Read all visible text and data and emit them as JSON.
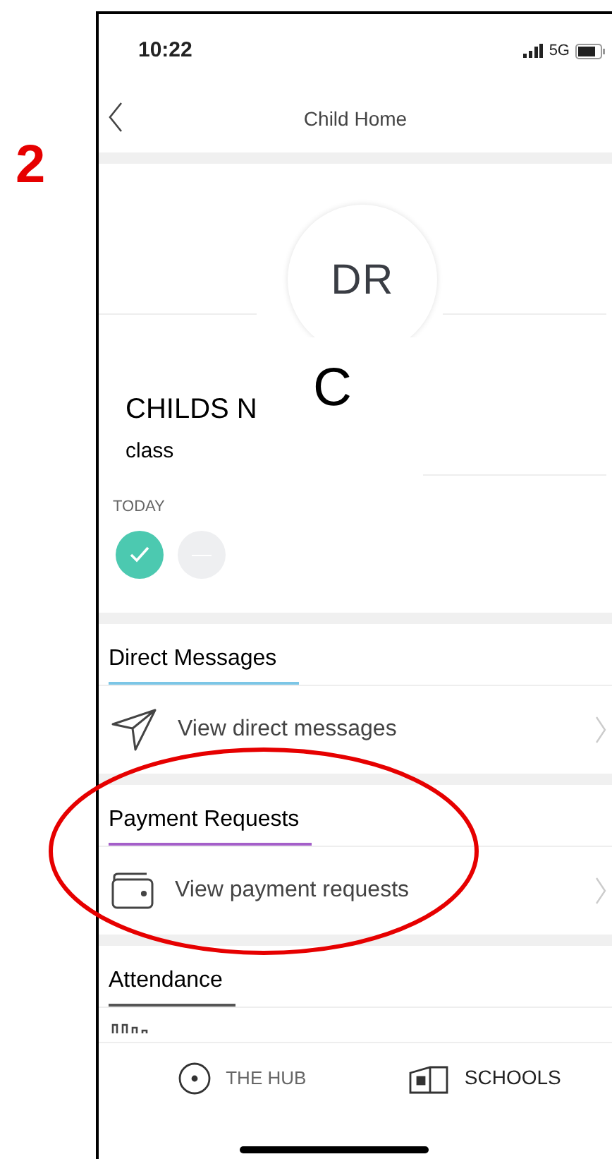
{
  "annotation": {
    "step": "2"
  },
  "status_bar": {
    "time": "10:22",
    "network": "5G"
  },
  "nav": {
    "title": "Child Home"
  },
  "profile": {
    "initials": "DR",
    "overlay_letter": "C",
    "name": "CHILDS N",
    "class": "class"
  },
  "today": {
    "label": "TODAY",
    "marks": [
      {
        "kind": "present"
      },
      {
        "kind": "none"
      }
    ]
  },
  "sections": [
    {
      "title": "Direct Messages",
      "color": "#7cc6e6",
      "row": {
        "label": "View direct messages"
      },
      "highlighted": false
    },
    {
      "title": "Payment Requests",
      "color": "#a45fc9",
      "row": {
        "label": "View payment requests"
      },
      "highlighted": true
    },
    {
      "title": "Attendance",
      "color": "#555555",
      "highlighted": false
    }
  ],
  "tab_bar": [
    {
      "label": "THE HUB"
    },
    {
      "label": "SCHOOLS"
    }
  ]
}
